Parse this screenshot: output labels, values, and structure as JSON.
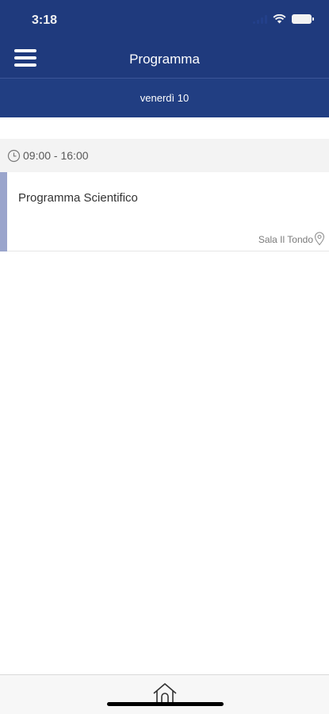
{
  "status_bar": {
    "time": "3:18"
  },
  "nav": {
    "title": "Programma"
  },
  "day_tab": {
    "label": "venerdì 10"
  },
  "timeslot": {
    "range": "09:00 - 16:00"
  },
  "session": {
    "title": "Programma Scientifico",
    "room": "Sala Il Tondo"
  },
  "colors": {
    "header": "#1f3a7d",
    "accent_bar": "#9aa5cc"
  },
  "icons": {
    "menu": "hamburger-icon",
    "clock": "clock-icon",
    "location": "map-pin-icon",
    "home": "home-icon"
  }
}
